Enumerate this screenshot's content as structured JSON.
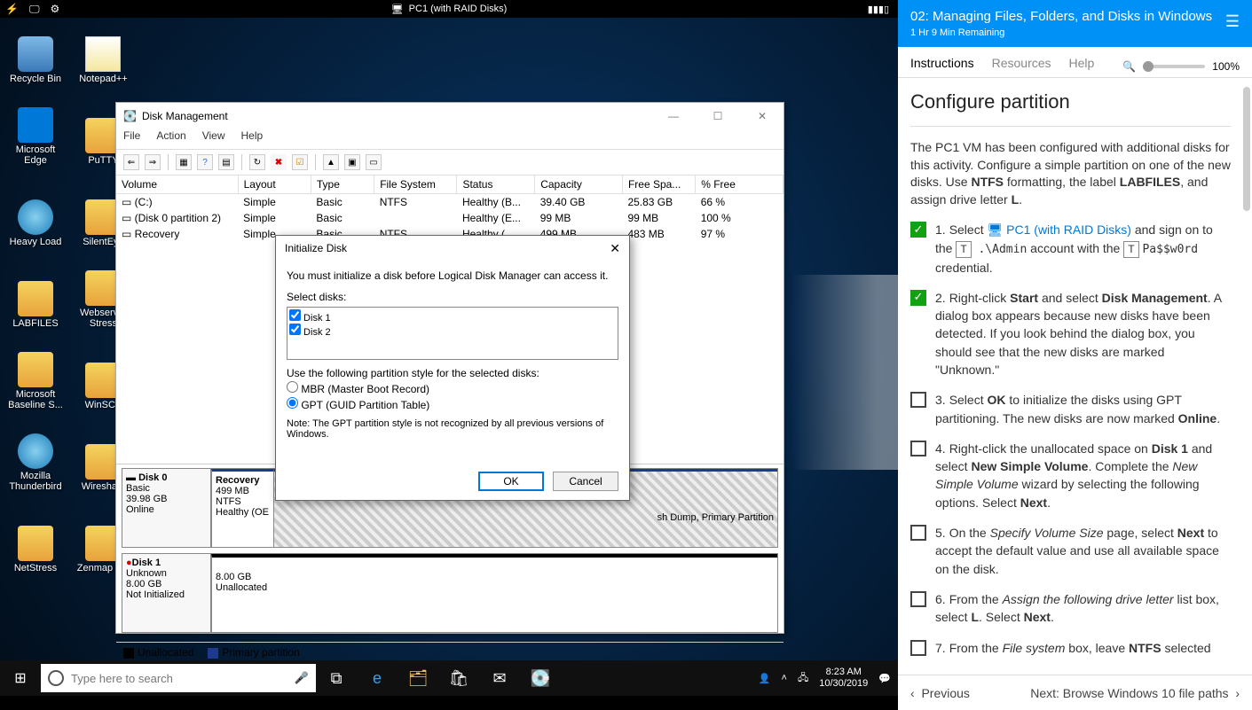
{
  "topbar": {
    "vm_title": "PC1 (with RAID Disks)"
  },
  "desktop_icons_col1": [
    "Recycle Bin",
    "Microsoft Edge",
    "Heavy Load",
    "LABFILES",
    "Microsoft Baseline S...",
    "Mozilla Thunderbird",
    "NetStress"
  ],
  "desktop_icons_col2": [
    "Notepad++",
    "PuTTY",
    "SilentEye",
    "Webserver Stress",
    "WinSCP",
    "Wireshark",
    "Zenmap - ..."
  ],
  "dm": {
    "title": "Disk Management",
    "menus": [
      "File",
      "Action",
      "View",
      "Help"
    ],
    "cols": [
      "Volume",
      "Layout",
      "Type",
      "File System",
      "Status",
      "Capacity",
      "Free Spa...",
      "% Free"
    ],
    "rows": [
      {
        "v": "(C:)",
        "l": "Simple",
        "t": "Basic",
        "fs": "NTFS",
        "s": "Healthy (B...",
        "c": "39.40 GB",
        "f": "25.83 GB",
        "p": "66 %"
      },
      {
        "v": "(Disk 0 partition 2)",
        "l": "Simple",
        "t": "Basic",
        "fs": "",
        "s": "Healthy (E...",
        "c": "99 MB",
        "f": "99 MB",
        "p": "100 %"
      },
      {
        "v": "Recovery",
        "l": "Simple",
        "t": "Basic",
        "fs": "NTFS",
        "s": "Healthy (...",
        "c": "499 MB",
        "f": "483 MB",
        "p": "97 %"
      }
    ],
    "disk0": {
      "name": "Disk 0",
      "sub1": "Basic",
      "sub2": "39.98 GB",
      "sub3": "Online",
      "p1": "Recovery",
      "p1b": "499 MB NTFS",
      "p1c": "Healthy (OE",
      "p3": "sh Dump, Primary Partition"
    },
    "disk1": {
      "name": "Disk 1",
      "sub1": "Unknown",
      "sub2": "8.00 GB",
      "sub3": "Not Initialized",
      "p1": "8.00 GB",
      "p2": "Unallocated"
    },
    "legend1": "Unallocated",
    "legend2": "Primary partition"
  },
  "init": {
    "title": "Initialize Disk",
    "msg": "You must initialize a disk before Logical Disk Manager can access it.",
    "sel": "Select disks:",
    "disks": [
      "Disk 1",
      "Disk 2"
    ],
    "style_label": "Use the following partition style for the selected disks:",
    "opt1": "MBR (Master Boot Record)",
    "opt2": "GPT (GUID Partition Table)",
    "note": "Note: The GPT partition style is not recognized by all previous versions of Windows.",
    "ok": "OK",
    "cancel": "Cancel"
  },
  "taskbar": {
    "search": "Type here to search",
    "time": "8:23 AM",
    "date": "10/30/2019"
  },
  "instr": {
    "head": "02: Managing Files, Folders, and Disks in Windows",
    "time": "1 Hr 9 Min Remaining",
    "tabs": [
      "Instructions",
      "Resources",
      "Help"
    ],
    "zoom": "100%",
    "h2": "Configure partition",
    "intro_parts": [
      "The PC1 VM has been configured with additional disks for this activity. Configure a simple partition on one of the new disks. Use ",
      "NTFS",
      " formatting, the label ",
      "LABFILES",
      ", and assign drive letter ",
      "L",
      "."
    ],
    "steps": [
      {
        "done": true,
        "n": "1.",
        "html_parts": [
          "Select ",
          "PC1 (with RAID Disks)",
          " and sign on to the ",
          ".\\Admin",
          " account with the ",
          "Pa$$w0rd",
          " credential."
        ]
      },
      {
        "done": true,
        "n": "2.",
        "html_parts": [
          "Right-click ",
          "Start",
          " and select ",
          "Disk Management",
          ". A dialog box appears because new disks have been detected. If you look behind the dialog box, you should see that the new disks are marked \"Unknown.\""
        ]
      },
      {
        "done": false,
        "n": "3.",
        "html_parts": [
          "Select ",
          "OK",
          " to initialize the disks using GPT partitioning. The new disks are now marked ",
          "Online",
          "."
        ]
      },
      {
        "done": false,
        "n": "4.",
        "html_parts": [
          "Right-click the unallocated space on ",
          "Disk 1",
          " and select ",
          "New Simple Volume",
          ". Complete the ",
          "New Simple Volume",
          " wizard by selecting the following options. Select ",
          "Next",
          "."
        ]
      },
      {
        "done": false,
        "n": "5.",
        "html_parts": [
          "On the ",
          "Specify Volume Size",
          " page, select ",
          "Next",
          " to accept the default value and use all available space on the disk."
        ]
      },
      {
        "done": false,
        "n": "6.",
        "html_parts": [
          "From the ",
          "Assign the following drive letter",
          " list box, select ",
          "L",
          ". Select ",
          "Next",
          "."
        ]
      },
      {
        "done": false,
        "n": "7.",
        "html_parts": [
          "From the ",
          "File system",
          " box, leave ",
          "NTFS",
          " selected"
        ]
      }
    ],
    "prev": "Previous",
    "next": "Next: Browse Windows 10 file paths"
  }
}
